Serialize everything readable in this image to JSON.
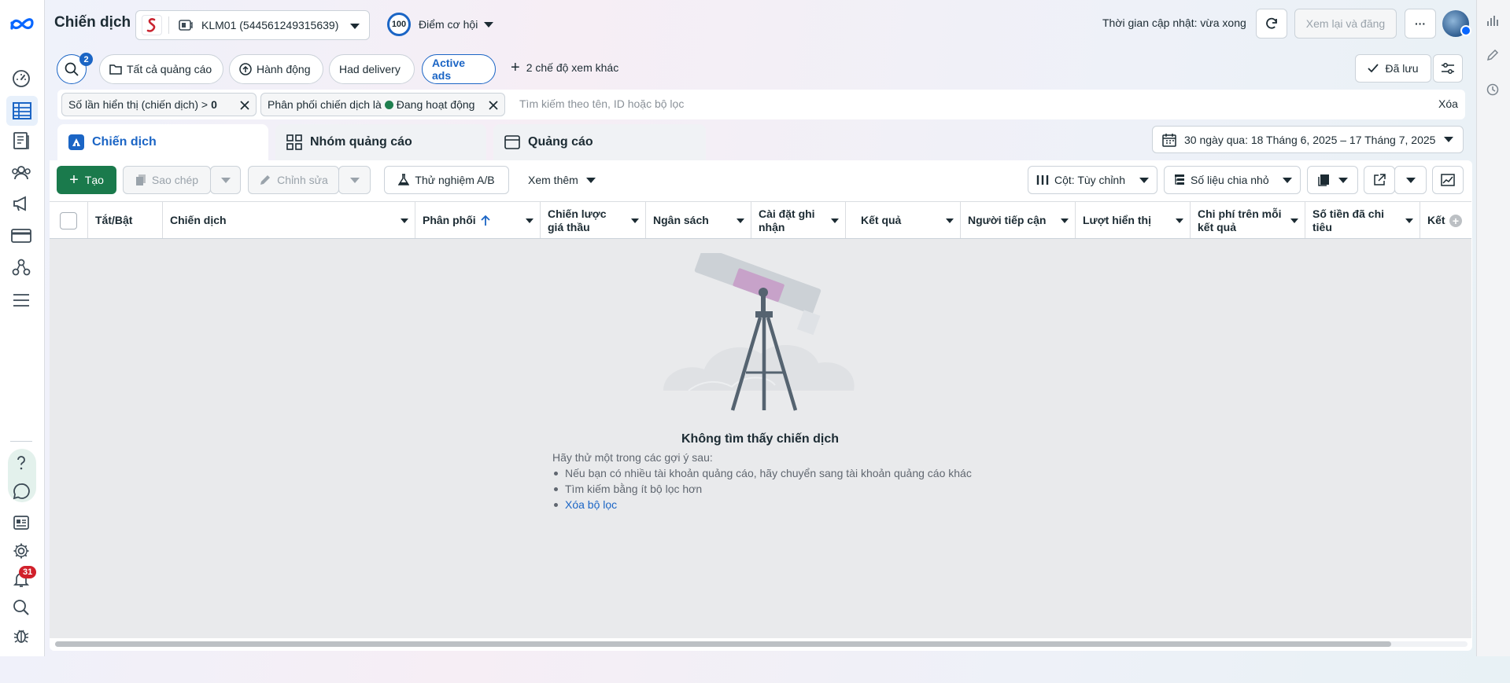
{
  "header": {
    "title": "Chiến dịch",
    "account": "KLM01 (544561249315639)",
    "opportunity_score": "100",
    "opportunity_label": "Điểm cơ hội",
    "update_status": "Thời gian cập nhật: vừa xong",
    "review_publish": "Xem lại và đăng",
    "more": "···"
  },
  "leftnav": {
    "notifications_count": "31"
  },
  "views": {
    "search_count": "2",
    "all_ads": "Tất cả quảng cáo",
    "actions": "Hành động",
    "had_delivery": "Had delivery",
    "active_ads": "Active ads",
    "more_views": "2 chế độ xem khác",
    "saved": "Đã lưu"
  },
  "filters": {
    "chip1_text": "Số lần hiển thị (chiến dịch) >",
    "chip1_value": "0",
    "chip2_text": "Phân phối chiến dịch là",
    "chip2_value": "Đang hoạt động",
    "search_placeholder": "Tìm kiếm theo tên, ID hoặc bộ lọc",
    "clear": "Xóa"
  },
  "tabs": [
    {
      "label": "Chiến dịch"
    },
    {
      "label": "Nhóm quảng cáo"
    },
    {
      "label": "Quảng cáo"
    }
  ],
  "date_range": "30 ngày qua: 18 Tháng 6, 2025 – 17 Tháng 7, 2025",
  "toolbar": {
    "create": "Tạo",
    "duplicate": "Sao chép",
    "edit": "Chỉnh sửa",
    "ab_test": "Thử nghiệm A/B",
    "view_more": "Xem thêm",
    "columns": "Cột: Tùy chỉnh",
    "breakdown": "Số liệu chia nhỏ"
  },
  "table": {
    "columns": [
      "Tắt/Bật",
      "Chiến dịch",
      "Phân phối",
      "Chiến lược giá thầu",
      "Ngân sách",
      "Cài đặt ghi nhận",
      "Kết quả",
      "Người tiếp cận",
      "Lượt hiển thị",
      "Chi phí trên mỗi kết quả",
      "Số tiền đã chi tiêu",
      "Kết"
    ]
  },
  "empty_state": {
    "title": "Không tìm thấy chiến dịch",
    "subtitle": "Hãy thử một trong các gợi ý sau:",
    "suggestions": [
      "Nếu bạn có nhiều tài khoản quảng cáo, hãy chuyển sang tài khoản quảng cáo khác",
      "Tìm kiếm bằng ít bộ lọc hơn"
    ],
    "clear_filters_link": "Xóa bộ lọc"
  },
  "colors": {
    "brand_blue": "#1b65c5",
    "create_green": "#1a7a4c",
    "active_dot": "#1f7f4f",
    "badge_red": "#d1202b"
  }
}
